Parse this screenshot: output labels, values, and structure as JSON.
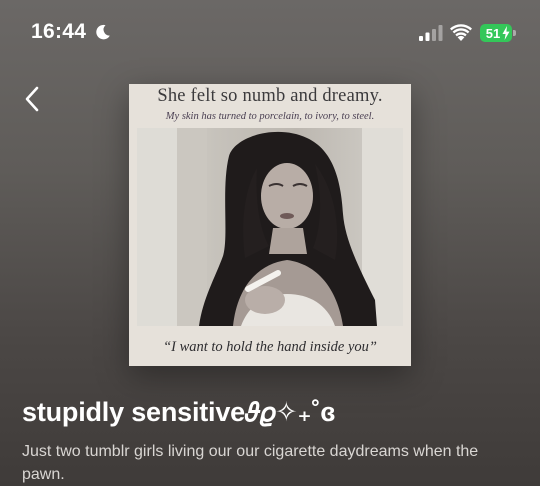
{
  "status_bar": {
    "time": "16:44",
    "battery": "51",
    "icons": [
      "moon-icon",
      "signal-icon",
      "wifi-icon",
      "battery-icon",
      "charging-bolt-icon"
    ],
    "battery_color": "#34c759"
  },
  "nav": {
    "back_icon": "chevron-left-icon"
  },
  "cover": {
    "headline": "She felt so numb and dreamy.",
    "subline": "My skin has turned to porcelain, to ivory, to steel.",
    "quote": "“I want to hold the hand inside you”"
  },
  "playlist": {
    "title": "stupidly sensitive𝜗𝜚✧₊˚ɞ",
    "description": "Just two tumblr girls living our our cigarette daydreams when the pawn."
  }
}
